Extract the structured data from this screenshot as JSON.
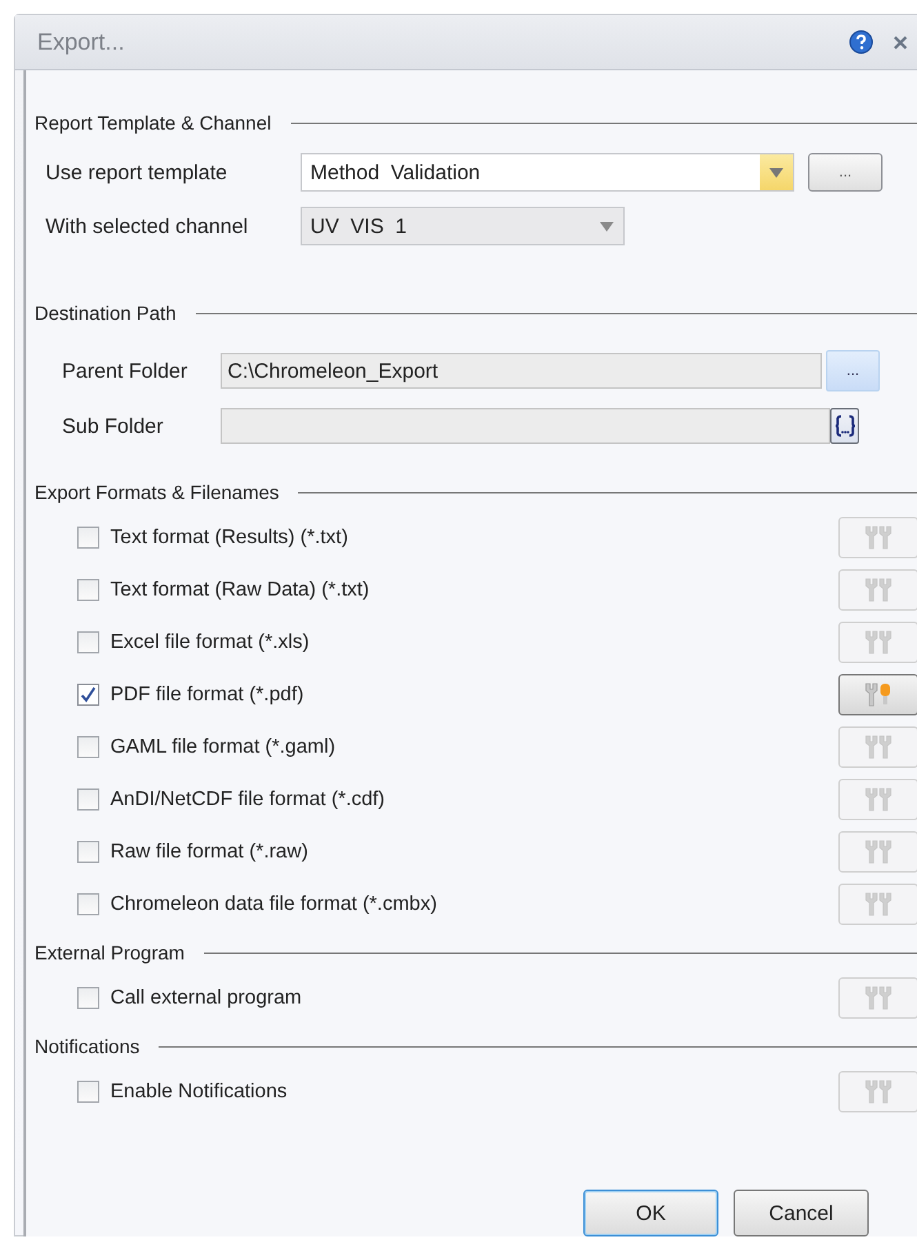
{
  "window": {
    "title": "Export..."
  },
  "report_template": {
    "title": "Report Template & Channel",
    "template": {
      "label": "Use report template",
      "value": "Method  Validation",
      "button": "..."
    },
    "channel": {
      "label": "With selected channel",
      "value": "UV  VIS  1",
      "disabled": true
    }
  },
  "destination": {
    "title": "Destination Path",
    "parent_folder": {
      "label": "Parent Folder",
      "value": "C:\\Chromeleon_Export",
      "button": "..."
    },
    "sub_folder": {
      "label": "Sub Folder"
    }
  },
  "export_formats": {
    "title": "Export Formats & Filenames",
    "items": [
      {
        "label": "Text format (Results) (*.txt)",
        "checked": false
      },
      {
        "label": "Text format (Raw Data) (*.txt)",
        "checked": false
      },
      {
        "label": "Excel file format (*.xls)",
        "checked": false
      },
      {
        "label": "PDF file format (*.pdf)",
        "checked": true
      },
      {
        "label": "GAML file format (*.gaml)",
        "checked": false
      },
      {
        "label": "AnDI/NetCDF file format (*.cdf)",
        "checked": false
      },
      {
        "label": "Raw file format (*.raw)",
        "checked": false
      },
      {
        "label": "Chromeleon data file format (*.cmbx)",
        "checked": false
      }
    ]
  },
  "external_program": {
    "title": "External Program",
    "items": [
      {
        "label": "Call external program",
        "checked": false
      }
    ]
  },
  "notifications": {
    "title": "Notifications",
    "items": [
      {
        "label": "Enable Notifications",
        "checked": false
      }
    ]
  },
  "buttons": [
    {
      "label": "OK",
      "default": true
    },
    {
      "label": "Cancel",
      "default": false
    }
  ]
}
